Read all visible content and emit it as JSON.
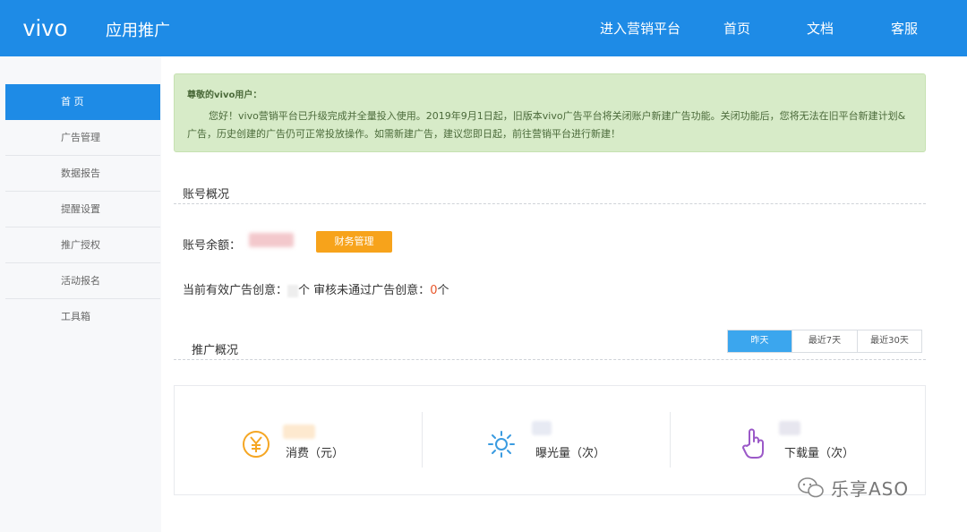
{
  "header": {
    "logo": "vivo",
    "product": "应用推广",
    "nav": [
      "进入营销平台",
      "首页",
      "文档",
      "客服"
    ]
  },
  "sidebar": {
    "items": [
      {
        "label": "首 页",
        "active": true
      },
      {
        "label": "广告管理"
      },
      {
        "label": "数据报告"
      },
      {
        "label": "提醒设置"
      },
      {
        "label": "推广授权"
      },
      {
        "label": "活动报名"
      },
      {
        "label": "工具箱"
      }
    ]
  },
  "notice": {
    "title": "尊敬的vivo用户：",
    "body": "您好！vivo营销平台已升级完成并全量投入使用。2019年9月1日起，旧版本vivo广告平台将关闭账户新建广告功能。关闭功能后，您将无法在旧平台新建计划&广告，历史创建的广告仍可正常投放操作。如需新建广告，建议您即日起，前往营销平台进行新建！"
  },
  "account": {
    "title": "账号概况",
    "balance_label": "账号余额：",
    "finance_button": "财务管理",
    "creative_prefix": "当前有效广告创意：",
    "creative_unit": "个",
    "rejected_label": "审核未通过广告创意：",
    "rejected_value": "0",
    "rejected_unit": "个"
  },
  "promo": {
    "title": "推广概况",
    "tabs": [
      {
        "label": "昨天",
        "active": true
      },
      {
        "label": "最近7天"
      },
      {
        "label": "最近30天"
      }
    ],
    "stats": [
      {
        "label": "消费（元）",
        "icon": "yuan-icon"
      },
      {
        "label": "曝光量（次）",
        "icon": "sun-icon"
      },
      {
        "label": "下载量（次）",
        "icon": "hand-pointer-icon"
      }
    ]
  },
  "watermark": "乐享ASO",
  "colors": {
    "primary": "#1e8be6",
    "notice_bg": "#d7ebc8",
    "button_orange": "#f7a31b",
    "icon_orange": "#f5a623",
    "icon_blue": "#3a9be0",
    "icon_purple": "#9b59c8"
  }
}
